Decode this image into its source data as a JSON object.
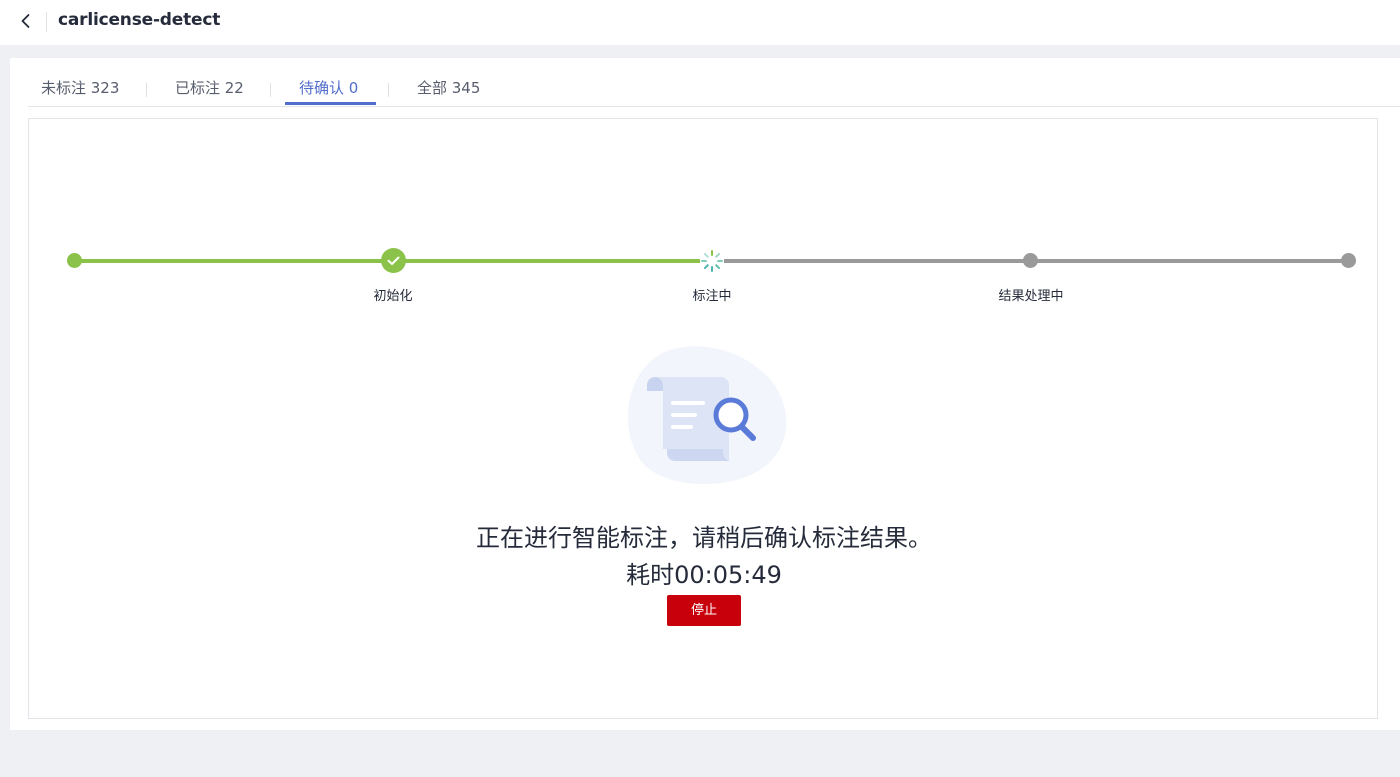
{
  "header": {
    "title": "carlicense-detect"
  },
  "tabs": [
    {
      "label": "未标注 323",
      "active": false
    },
    {
      "label": "已标注 22",
      "active": false
    },
    {
      "label": "待确认 0",
      "active": true
    },
    {
      "label": "全部 345",
      "active": false
    }
  ],
  "steps": [
    {
      "label": "",
      "status": "done"
    },
    {
      "label": "初始化",
      "status": "done"
    },
    {
      "label": "标注中",
      "status": "in-progress"
    },
    {
      "label": "结果处理中",
      "status": "pending"
    },
    {
      "label": "",
      "status": "pending"
    }
  ],
  "status": {
    "message": "正在进行智能标注，请稍后确认标注结果。",
    "elapsed": "耗时00:05:49",
    "stop_label": "停止"
  },
  "colors": {
    "accent": "#526ecc",
    "done": "#8bc34a",
    "pending": "#9a9a9a",
    "stop": "#c7000b"
  },
  "icons": {
    "back": "chevron-left-icon",
    "check": "check-icon",
    "spinner": "loading-spinner-icon",
    "illustration": "document-search-icon"
  }
}
